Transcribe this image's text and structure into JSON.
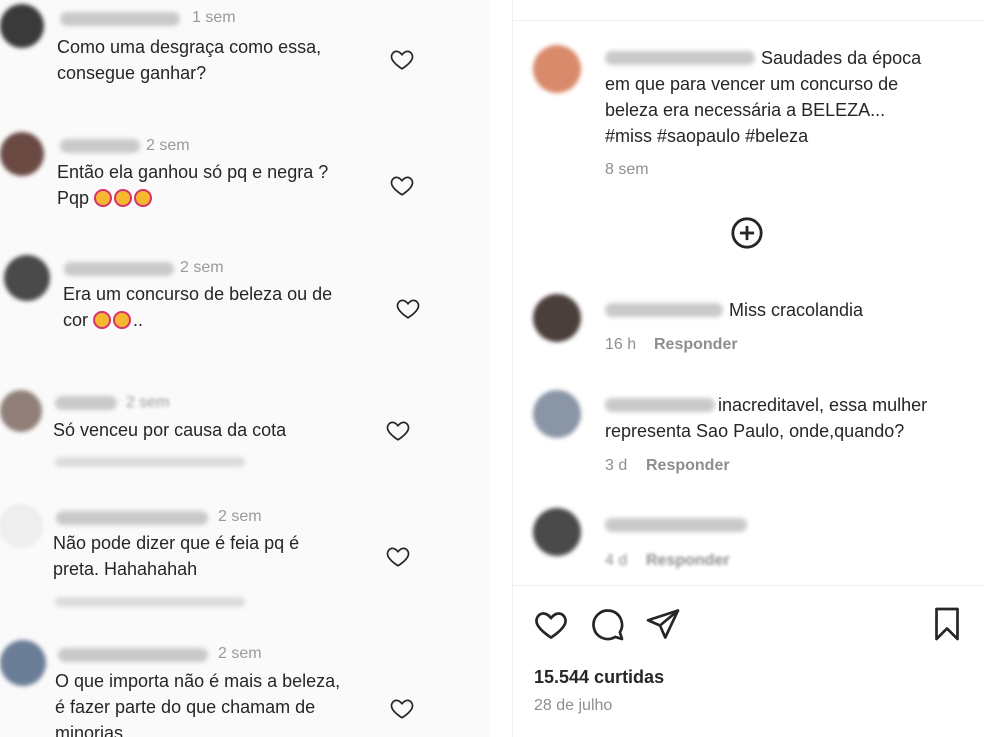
{
  "left_comments": [
    {
      "time": "1 sem",
      "lines": [
        "Como uma desgraça como essa,",
        "consegue ganhar?"
      ],
      "emoji": 0
    },
    {
      "time": "2 sem",
      "lines": [
        "Então ela ganhou só pq e negra ?",
        "Pqp"
      ],
      "emoji": 3
    },
    {
      "time": "2 sem",
      "lines": [
        "Era um concurso de beleza ou de",
        "cor"
      ],
      "emoji": 2,
      "suffix": ".."
    },
    {
      "time": "2 sem",
      "lines": [
        "Só venceu por causa da cota"
      ],
      "emoji": 0
    },
    {
      "time": "2 sem",
      "lines": [
        "Não pode dizer que é feia pq é",
        "preta. Hahahahah"
      ],
      "emoji": 0
    },
    {
      "time": "2 sem",
      "lines": [
        "O que importa não é mais a beleza,",
        "é fazer parte do que chamam de",
        "minorias"
      ],
      "emoji": 0
    }
  ],
  "post": {
    "caption_lines": [
      "Saudades da época",
      "em que para vencer um concurso de",
      "beleza era necessária a BELEZA...",
      "#miss #saopaulo #beleza"
    ],
    "caption_time": "8 sem"
  },
  "right_comments": [
    {
      "lines": [
        "Miss cracolandia"
      ],
      "time": "16 h",
      "reply": "Responder"
    },
    {
      "lines": [
        "inacreditavel, essa mulher",
        "representa Sao Paulo, onde,quando?"
      ],
      "time": "3 d",
      "reply": "Responder"
    },
    {
      "lines": [
        ""
      ],
      "time": "4 d",
      "reply": "Responder"
    }
  ],
  "likes": "15.544 curtidas",
  "date": "28 de julho",
  "icons": {
    "heart": "heart-icon",
    "comment": "comment-icon",
    "share": "share-icon",
    "save": "bookmark-icon",
    "add": "add-circle-icon"
  }
}
